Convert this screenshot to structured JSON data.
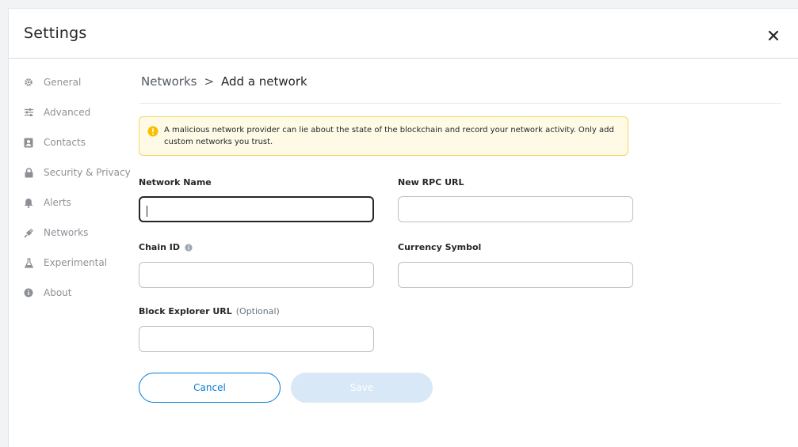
{
  "header": {
    "title": "Settings"
  },
  "sidebar": {
    "items": [
      {
        "label": "General",
        "icon": "gear-icon"
      },
      {
        "label": "Advanced",
        "icon": "sliders-icon"
      },
      {
        "label": "Contacts",
        "icon": "contact-book-icon"
      },
      {
        "label": "Security & Privacy",
        "icon": "lock-icon"
      },
      {
        "label": "Alerts",
        "icon": "bell-icon"
      },
      {
        "label": "Networks",
        "icon": "plug-icon"
      },
      {
        "label": "Experimental",
        "icon": "flask-icon"
      },
      {
        "label": "About",
        "icon": "info-icon"
      }
    ]
  },
  "breadcrumb": {
    "parent": "Networks",
    "separator": ">",
    "current": "Add a network"
  },
  "warning": {
    "text": "A malicious network provider can lie about the state of the blockchain and record your network activity. Only add custom networks you trust.",
    "icon": "warning-icon"
  },
  "form": {
    "network_name": {
      "label": "Network Name",
      "value": ""
    },
    "rpc_url": {
      "label": "New RPC URL",
      "value": ""
    },
    "chain_id": {
      "label": "Chain ID",
      "value": ""
    },
    "currency_symbol": {
      "label": "Currency Symbol",
      "value": ""
    },
    "block_explorer": {
      "label": "Block Explorer URL",
      "optional": "(Optional)",
      "value": ""
    }
  },
  "buttons": {
    "cancel": "Cancel",
    "save": "Save"
  },
  "colors": {
    "accent": "#037dd6",
    "warning_bg": "#fefae6",
    "warning_border": "#f4d665",
    "save_disabled": "#d9e8f6"
  }
}
